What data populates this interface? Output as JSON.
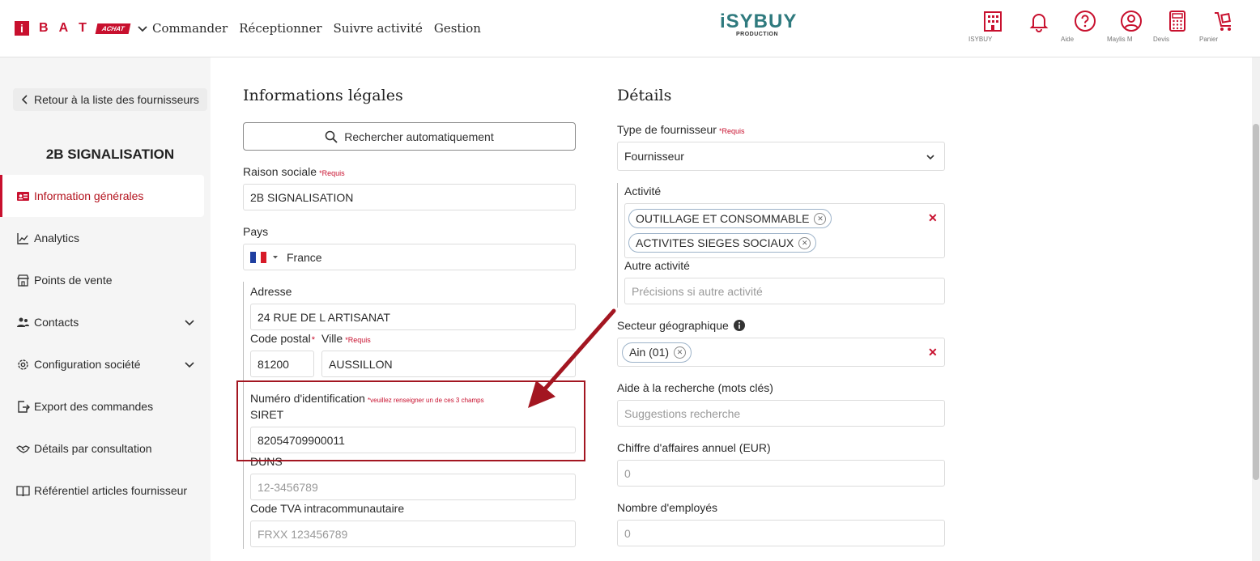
{
  "header": {
    "brand_letters": [
      "B",
      "A",
      "T"
    ],
    "brand_i": "i",
    "brand_achat": "ACHAT",
    "nav": [
      "Commander",
      "Réceptionner",
      "Suivre activité",
      "Gestion"
    ],
    "logo_main": "iSYBUY",
    "logo_sub": "PRODUCTION",
    "icons": [
      {
        "name": "building-icon",
        "label": "ISYBUY"
      },
      {
        "name": "bell-icon",
        "label": ""
      },
      {
        "name": "help-icon",
        "label": "Aide"
      },
      {
        "name": "user-icon",
        "label": "Maylis M"
      },
      {
        "name": "calculator-icon",
        "label": "Devis"
      },
      {
        "name": "cart-icon",
        "label": "Panier"
      }
    ],
    "accent": "#c8102e"
  },
  "sidebar": {
    "back_label": "Retour à la liste des fournisseurs",
    "company": "2B SIGNALISATION",
    "items": [
      {
        "label": "Information générales",
        "icon": "id-card-icon"
      },
      {
        "label": "Analytics",
        "icon": "chart-line-icon"
      },
      {
        "label": "Points de vente",
        "icon": "store-icon"
      },
      {
        "label": "Contacts",
        "icon": "people-icon"
      },
      {
        "label": "Configuration société",
        "icon": "settings-icon"
      },
      {
        "label": "Export des commandes",
        "icon": "export-icon"
      },
      {
        "label": "Détails par consultation",
        "icon": "handshake-icon"
      },
      {
        "label": "Référentiel articles fournisseur",
        "icon": "book-icon"
      }
    ]
  },
  "legal": {
    "title": "Informations légales",
    "search_btn": "Rechercher automatiquement",
    "raison_label": "Raison sociale",
    "required": "*Requis",
    "raison_value": "2B SIGNALISATION",
    "pays_label": "Pays",
    "pays_value": "France",
    "adresse_label": "Adresse",
    "adresse_value": "24 RUE DE L ARTISANAT",
    "cp_label": "Code postal",
    "cp_star": "*",
    "cp_value": "81200",
    "ville_label": "Ville",
    "ville_value": "AUSSILLON",
    "ident_label": "Numéro d'identification",
    "ident_note": "*veuillez renseigner un de ces 3 champs",
    "siret_label": "SIRET",
    "siret_value": "82054709900011",
    "duns_label": "DUNS",
    "duns_placeholder": "12-3456789",
    "tva_label": "Code TVA intracommunautaire",
    "tva_placeholder": "FRXX 123456789"
  },
  "details": {
    "title": "Détails",
    "type_label": "Type de fournisseur",
    "type_value": "Fournisseur",
    "activite_label": "Activité",
    "activites": [
      "OUTILLAGE ET CONSOMMABLE",
      "ACTIVITES SIEGES SOCIAUX"
    ],
    "autre_label": "Autre activité",
    "autre_placeholder": "Précisions si autre activité",
    "secteur_label": "Secteur géographique",
    "secteur_chip": "Ain (01)",
    "aide_label": "Aide à la recherche (mots clés)",
    "aide_placeholder": "Suggestions recherche",
    "ca_label": "Chiffre d'affaires annuel (EUR)",
    "ca_placeholder": "0",
    "emp_label": "Nombre d'employés",
    "emp_placeholder": "0"
  }
}
